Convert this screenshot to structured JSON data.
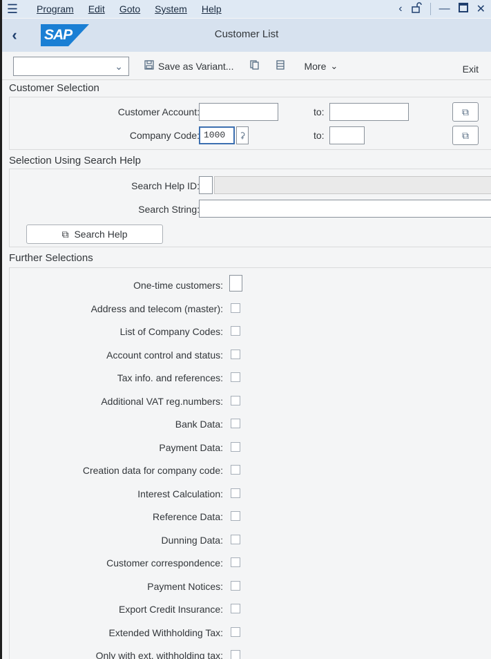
{
  "menubar": {
    "items": [
      "Program",
      "Edit",
      "Goto",
      "System",
      "Help"
    ]
  },
  "titlebar": {
    "logo": "SAP",
    "title": "Customer List"
  },
  "toolbar": {
    "variant_value": "",
    "save_variant": "Save as Variant...",
    "more": "More",
    "exit": "Exit"
  },
  "customer_selection": {
    "title": "Customer Selection",
    "customer_account_label": "Customer Account:",
    "customer_account_from": "",
    "customer_account_to_label": "to:",
    "customer_account_to": "",
    "company_code_label": "Company Code:",
    "company_code_from": "1000",
    "company_code_to_label": "to:",
    "company_code_to": ""
  },
  "search_help": {
    "title": "Selection Using Search Help",
    "search_help_id_label": "Search Help ID:",
    "search_help_id": "",
    "search_string_label": "Search String:",
    "search_string": "",
    "button": "Search Help"
  },
  "further": {
    "title": "Further Selections",
    "items": [
      "One-time customers:",
      "Address and telecom (master):",
      "List of Company Codes:",
      "Account control and status:",
      "Tax info. and references:",
      "Additional VAT reg.numbers:",
      "Bank Data:",
      "Payment Data:",
      "Creation data for company code:",
      "Interest Calculation:",
      "Reference Data:",
      "Dunning Data:",
      "Customer correspondence:",
      "Payment Notices:",
      "Export Credit Insurance:",
      "Extended Withholding Tax:",
      "Only with ext. withholding tax:"
    ]
  }
}
